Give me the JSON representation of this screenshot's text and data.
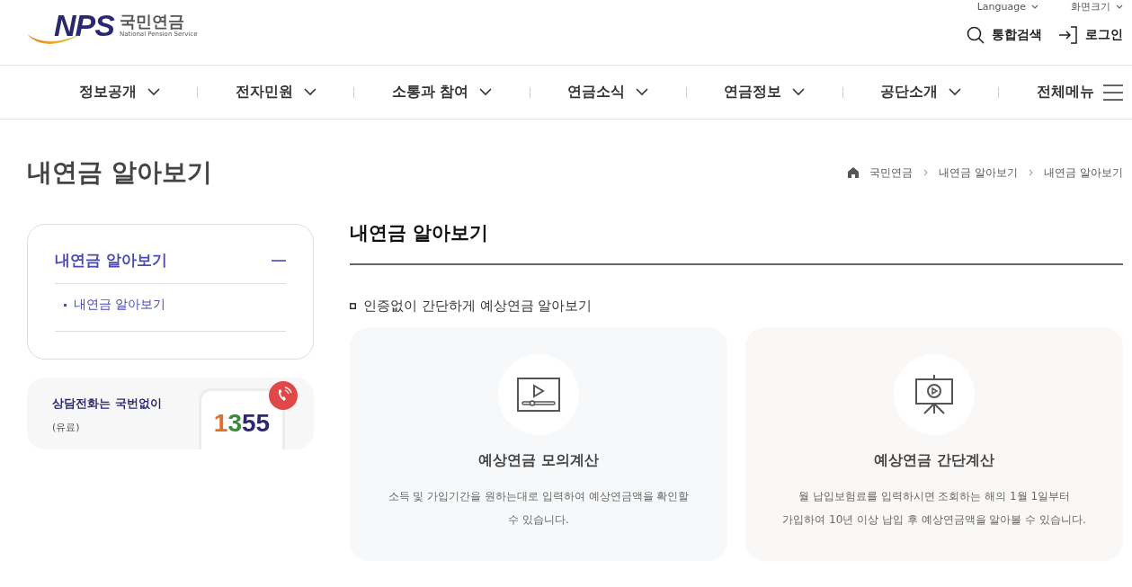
{
  "logo": {
    "mark": "NPS",
    "name": "국민연금",
    "subtitle": "National Pension Service"
  },
  "utility_links": [
    "Language",
    "화면크기"
  ],
  "header_actions": [
    {
      "kind": "search",
      "label": "통합검색"
    },
    {
      "kind": "login",
      "label": "로그인"
    }
  ],
  "nav": [
    {
      "label": "정보공개",
      "kind": "dropdown"
    },
    {
      "label": "전자민원",
      "kind": "dropdown"
    },
    {
      "label": "소통과 참여",
      "kind": "dropdown"
    },
    {
      "label": "연금소식",
      "kind": "dropdown"
    },
    {
      "label": "연금정보",
      "kind": "dropdown"
    },
    {
      "label": "공단소개",
      "kind": "dropdown"
    },
    {
      "label": "전체메뉴",
      "kind": "menu"
    }
  ],
  "page_title": "내연금 알아보기",
  "breadcrumb": [
    "국민연금",
    "내연금 알아보기",
    "내연금 알아보기"
  ],
  "sidebar": {
    "title": "내연금 알아보기",
    "expanded": true,
    "items": [
      {
        "label": "내연금 알아보기",
        "selected": true
      }
    ]
  },
  "call_banner": {
    "title": "상담전화는 국번없이",
    "note": "(유료)",
    "number": [
      "1",
      "3",
      "55"
    ]
  },
  "content": {
    "heading": "내연금 알아보기",
    "section": "인증없이 간단하게 예상연금 알아보기",
    "cards": [
      {
        "kind": "video",
        "title": "예상연금 모의계산",
        "lines": [
          "소득 및 가입기간을 원하는대로 입력하여 예상연금액을 확인할",
          "수 있습니다."
        ]
      },
      {
        "kind": "presentation",
        "title": "예상연금 간단계산",
        "lines": [
          "월 납입보험료를 입력하시면 조회하는 해의 1월 1일부터",
          "가입하여 10년 이상 납입 후 예상연금액을 알아볼 수 있습니다."
        ]
      }
    ]
  }
}
